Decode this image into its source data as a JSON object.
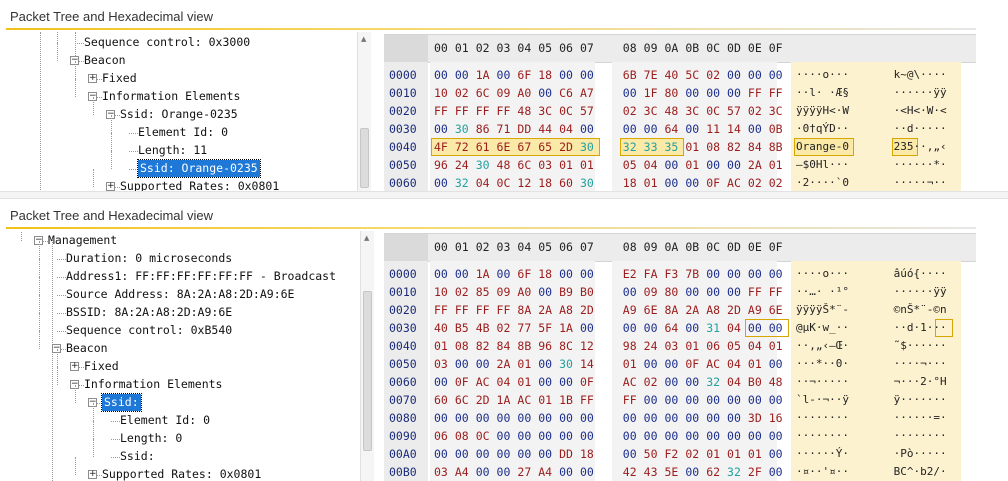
{
  "top_panel": {
    "title": "Packet Tree and Hexadecimal view",
    "tree": [
      {
        "text": "Sequence control: 0x3000",
        "has_expander": false,
        "selected": false
      },
      {
        "text": "Beacon",
        "has_expander": true,
        "expander": "−",
        "selected": false
      },
      {
        "text": "Fixed",
        "has_expander": true,
        "expander": "+",
        "selected": false
      },
      {
        "text": "Information Elements",
        "has_expander": true,
        "expander": "−",
        "selected": false
      },
      {
        "text": "Ssid: Orange-0235",
        "has_expander": true,
        "expander": "−",
        "selected": false
      },
      {
        "text": "Element Id: 0",
        "has_expander": false,
        "selected": false
      },
      {
        "text": "Length: 11",
        "has_expander": false,
        "selected": false
      },
      {
        "text": "Ssid: Orange-0235",
        "has_expander": false,
        "selected": true
      },
      {
        "text": "Supported Rates: 0x0801",
        "has_expander": true,
        "expander": "+",
        "selected": false
      }
    ],
    "hex_header": [
      "00",
      "01",
      "02",
      "03",
      "04",
      "05",
      "06",
      "07",
      "08",
      "09",
      "0A",
      "0B",
      "0C",
      "0D",
      "0E",
      "0F"
    ],
    "hex_rows": [
      {
        "offset": "0000",
        "bytes": [
          "00",
          "00",
          "1A",
          "00",
          "6F",
          "18",
          "00",
          "00",
          "6B",
          "7E",
          "40",
          "5C",
          "02",
          "00",
          "00",
          "00"
        ],
        "ascii_left": "····o···",
        "ascii_right": "k~@\\····"
      },
      {
        "offset": "0010",
        "bytes": [
          "10",
          "02",
          "6C",
          "09",
          "A0",
          "00",
          "C6",
          "A7",
          "00",
          "1F",
          "80",
          "00",
          "00",
          "00",
          "FF",
          "FF"
        ],
        "ascii_left": "··l· ·Æ§",
        "ascii_right": "······ÿÿ"
      },
      {
        "offset": "0020",
        "bytes": [
          "FF",
          "FF",
          "FF",
          "FF",
          "48",
          "3C",
          "0C",
          "57",
          "02",
          "3C",
          "48",
          "3C",
          "0C",
          "57",
          "02",
          "3C"
        ],
        "ascii_left": "ÿÿÿÿH<·W",
        "ascii_right": "·<H<·W·<"
      },
      {
        "offset": "0030",
        "bytes": [
          "00",
          "30",
          "86",
          "71",
          "DD",
          "44",
          "04",
          "00",
          "00",
          "00",
          "64",
          "00",
          "11",
          "14",
          "00",
          "0B"
        ],
        "ascii_left": "·0†qÝD··",
        "ascii_right": "··d·····"
      },
      {
        "offset": "0040",
        "bytes": [
          "4F",
          "72",
          "61",
          "6E",
          "67",
          "65",
          "2D",
          "30",
          "32",
          "33",
          "35",
          "01",
          "08",
          "82",
          "84",
          "8B"
        ],
        "ascii_left": "Orange-0",
        "ascii_right": "235··‚„‹"
      },
      {
        "offset": "0050",
        "bytes": [
          "96",
          "24",
          "30",
          "48",
          "6C",
          "03",
          "01",
          "01",
          "05",
          "04",
          "00",
          "01",
          "00",
          "00",
          "2A",
          "01"
        ],
        "ascii_left": "–$0Hl···",
        "ascii_right": "······*·"
      },
      {
        "offset": "0060",
        "bytes": [
          "00",
          "32",
          "04",
          "0C",
          "12",
          "18",
          "60",
          "30",
          "18",
          "01",
          "00",
          "00",
          "0F",
          "AC",
          "02",
          "02"
        ],
        "ascii_left": "·2····`0",
        "ascii_right": "·····¬··"
      }
    ]
  },
  "bottom_panel": {
    "title": "Packet Tree and Hexadecimal view",
    "tree": [
      {
        "text": "Management",
        "has_expander": true,
        "expander": "−",
        "selected": false
      },
      {
        "text": "Duration: 0 microseconds",
        "has_expander": false,
        "selected": false
      },
      {
        "text": "Address1: FF:FF:FF:FF:FF:FF - Broadcast",
        "has_expander": false,
        "selected": false
      },
      {
        "text": "Source Address: 8A:2A:A8:2D:A9:6E",
        "has_expander": false,
        "selected": false
      },
      {
        "text": "BSSID: 8A:2A:A8:2D:A9:6E",
        "has_expander": false,
        "selected": false
      },
      {
        "text": "Sequence control: 0xB540",
        "has_expander": false,
        "selected": false
      },
      {
        "text": "Beacon",
        "has_expander": true,
        "expander": "−",
        "selected": false
      },
      {
        "text": "Fixed",
        "has_expander": true,
        "expander": "+",
        "selected": false
      },
      {
        "text": "Information Elements",
        "has_expander": true,
        "expander": "−",
        "selected": false
      },
      {
        "text": "Ssid:",
        "has_expander": true,
        "expander": "−",
        "selected": true
      },
      {
        "text": "Element Id: 0",
        "has_expander": false,
        "selected": false
      },
      {
        "text": "Length: 0",
        "has_expander": false,
        "selected": false
      },
      {
        "text": "Ssid:",
        "has_expander": false,
        "selected": false
      },
      {
        "text": "Supported Rates: 0x0801",
        "has_expander": true,
        "expander": "+",
        "selected": false
      }
    ],
    "hex_header": [
      "00",
      "01",
      "02",
      "03",
      "04",
      "05",
      "06",
      "07",
      "08",
      "09",
      "0A",
      "0B",
      "0C",
      "0D",
      "0E",
      "0F"
    ],
    "hex_rows": [
      {
        "offset": "0000",
        "bytes": [
          "00",
          "00",
          "1A",
          "00",
          "6F",
          "18",
          "00",
          "00",
          "E2",
          "FA",
          "F3",
          "7B",
          "00",
          "00",
          "00",
          "00"
        ],
        "ascii_left": "····o···",
        "ascii_right": "âúó{····"
      },
      {
        "offset": "0010",
        "bytes": [
          "10",
          "02",
          "85",
          "09",
          "A0",
          "00",
          "B9",
          "B0",
          "00",
          "09",
          "80",
          "00",
          "00",
          "00",
          "FF",
          "FF"
        ],
        "ascii_left": "··…· ·¹°",
        "ascii_right": "······ÿÿ"
      },
      {
        "offset": "0020",
        "bytes": [
          "FF",
          "FF",
          "FF",
          "FF",
          "8A",
          "2A",
          "A8",
          "2D",
          "A9",
          "6E",
          "8A",
          "2A",
          "A8",
          "2D",
          "A9",
          "6E"
        ],
        "ascii_left": "ÿÿÿÿŠ*¨-",
        "ascii_right": "©nŠ*¨-©n"
      },
      {
        "offset": "0030",
        "bytes": [
          "40",
          "B5",
          "4B",
          "02",
          "77",
          "5F",
          "1A",
          "00",
          "00",
          "00",
          "64",
          "00",
          "31",
          "04",
          "00",
          "00"
        ],
        "ascii_left": "@µK·w_··",
        "ascii_right": "··d·1···"
      },
      {
        "offset": "0040",
        "bytes": [
          "01",
          "08",
          "82",
          "84",
          "8B",
          "96",
          "8C",
          "12",
          "98",
          "24",
          "03",
          "01",
          "06",
          "05",
          "04",
          "01"
        ],
        "ascii_left": "··‚„‹–Œ·",
        "ascii_right": "˜$······"
      },
      {
        "offset": "0050",
        "bytes": [
          "03",
          "00",
          "00",
          "2A",
          "01",
          "00",
          "30",
          "14",
          "01",
          "00",
          "00",
          "0F",
          "AC",
          "04",
          "01",
          "00"
        ],
        "ascii_left": "···*··0·",
        "ascii_right": "····¬···"
      },
      {
        "offset": "0060",
        "bytes": [
          "00",
          "0F",
          "AC",
          "04",
          "01",
          "00",
          "00",
          "0F",
          "AC",
          "02",
          "00",
          "00",
          "32",
          "04",
          "B0",
          "48"
        ],
        "ascii_left": "··¬·····",
        "ascii_right": "¬···2·°H"
      },
      {
        "offset": "0070",
        "bytes": [
          "60",
          "6C",
          "2D",
          "1A",
          "AC",
          "01",
          "1B",
          "FF",
          "FF",
          "00",
          "00",
          "00",
          "00",
          "00",
          "00",
          "00"
        ],
        "ascii_left": "`l-·¬··ÿ",
        "ascii_right": "ÿ·······"
      },
      {
        "offset": "0080",
        "bytes": [
          "00",
          "00",
          "00",
          "00",
          "00",
          "00",
          "00",
          "00",
          "00",
          "00",
          "00",
          "00",
          "00",
          "00",
          "3D",
          "16"
        ],
        "ascii_left": "········",
        "ascii_right": "······=·"
      },
      {
        "offset": "0090",
        "bytes": [
          "06",
          "08",
          "0C",
          "00",
          "00",
          "00",
          "00",
          "00",
          "00",
          "00",
          "00",
          "00",
          "00",
          "00",
          "00",
          "00"
        ],
        "ascii_left": "········",
        "ascii_right": "········"
      },
      {
        "offset": "00A0",
        "bytes": [
          "00",
          "00",
          "00",
          "00",
          "00",
          "00",
          "DD",
          "18",
          "00",
          "50",
          "F2",
          "02",
          "01",
          "01",
          "01",
          "00"
        ],
        "ascii_left": "······Ý·",
        "ascii_right": "·Pò·····"
      },
      {
        "offset": "00B0",
        "bytes": [
          "03",
          "A4",
          "00",
          "00",
          "27",
          "A4",
          "00",
          "00",
          "42",
          "43",
          "5E",
          "00",
          "62",
          "32",
          "2F",
          "00"
        ],
        "ascii_left": "·¤··'¤··",
        "ascii_right": "BC^·b2/·"
      }
    ]
  }
}
